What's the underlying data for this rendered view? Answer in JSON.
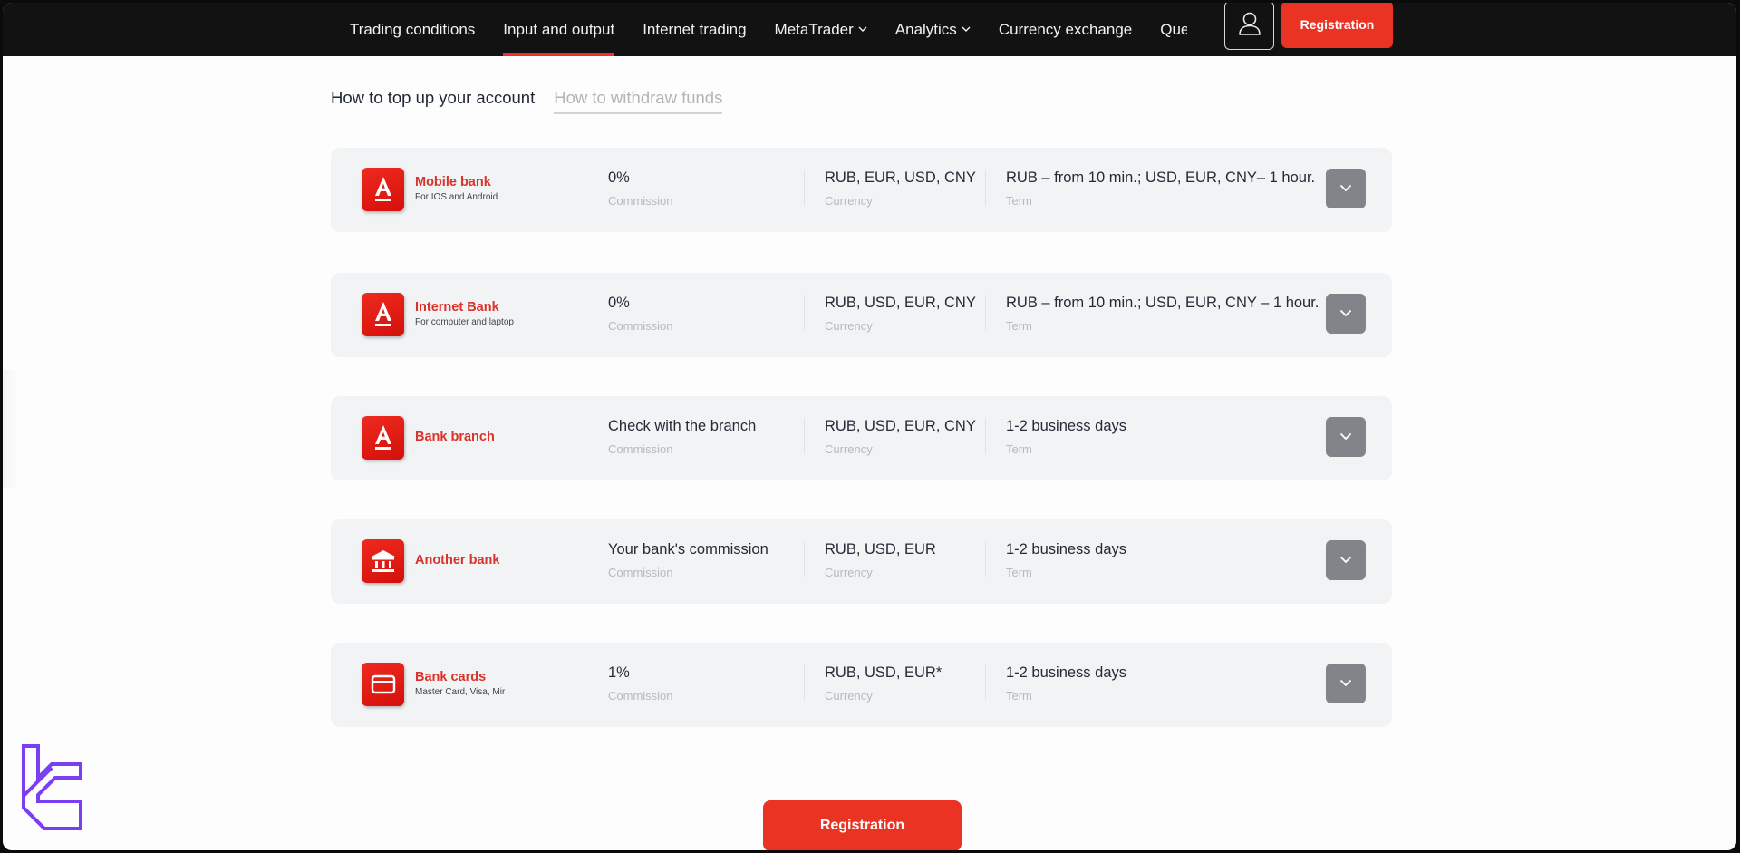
{
  "header": {
    "nav": [
      {
        "label": "Trading conditions",
        "active": false,
        "dropdown": false
      },
      {
        "label": "Input and output",
        "active": true,
        "dropdown": false
      },
      {
        "label": "Internet trading",
        "active": false,
        "dropdown": false
      },
      {
        "label": "MetaTrader",
        "active": false,
        "dropdown": true
      },
      {
        "label": "Analytics",
        "active": false,
        "dropdown": true
      },
      {
        "label": "Currency exchange",
        "active": false,
        "dropdown": false
      },
      {
        "label": "Que",
        "active": false,
        "dropdown": false
      }
    ],
    "user_icon": "user-icon",
    "registration_label": "Registration"
  },
  "tabs": [
    {
      "label": "How to top up your account",
      "active": true
    },
    {
      "label": "How to withdraw funds",
      "active": false
    }
  ],
  "methods": [
    {
      "title": "Mobile bank",
      "subtitle": "For IOS and Android",
      "icon": "alfa-bank-logo-icon",
      "commission": "0%",
      "commission_label": "Commission",
      "currency": "RUB, EUR, USD, CNY",
      "currency_label": "Currency",
      "term": "RUB – from 10 min.; USD, EUR, CNY– 1 hour.",
      "term_label": "Term"
    },
    {
      "title": "Internet Bank",
      "subtitle": "For computer and laptop",
      "icon": "alfa-bank-logo-icon",
      "commission": "0%",
      "commission_label": "Commission",
      "currency": "RUB, USD, EUR, CNY",
      "currency_label": "Currency",
      "term": "RUB – from 10 min.; USD, EUR, CNY – 1 hour.",
      "term_label": "Term"
    },
    {
      "title": "Bank branch",
      "subtitle": "",
      "icon": "alfa-bank-logo-icon",
      "commission": "Check with the branch",
      "commission_label": "Commission",
      "currency": "RUB, USD, EUR, CNY",
      "currency_label": "Currency",
      "term": "1-2 business days",
      "term_label": "Term"
    },
    {
      "title": "Another bank",
      "subtitle": "",
      "icon": "bank-building-icon",
      "commission": "Your bank's commission",
      "commission_label": "Commission",
      "currency": "RUB, USD, EUR",
      "currency_label": "Currency",
      "term": "1-2 business days",
      "term_label": "Term"
    },
    {
      "title": "Bank cards",
      "subtitle": "Master Card, Visa, Mir",
      "icon": "credit-card-icon",
      "commission": "1%",
      "commission_label": "Commission",
      "currency": "RUB, USD, EUR*",
      "currency_label": "Currency",
      "term": "1-2 business days",
      "term_label": "Term"
    }
  ],
  "registration_button_label": "Registration",
  "colors": {
    "accent": "#ea3323",
    "method_title": "#d9332b",
    "header_bg": "#121212",
    "card_bg": "#f2f3f5",
    "expand_button": "#818488",
    "watermark_logo": "#7b3ff2"
  }
}
